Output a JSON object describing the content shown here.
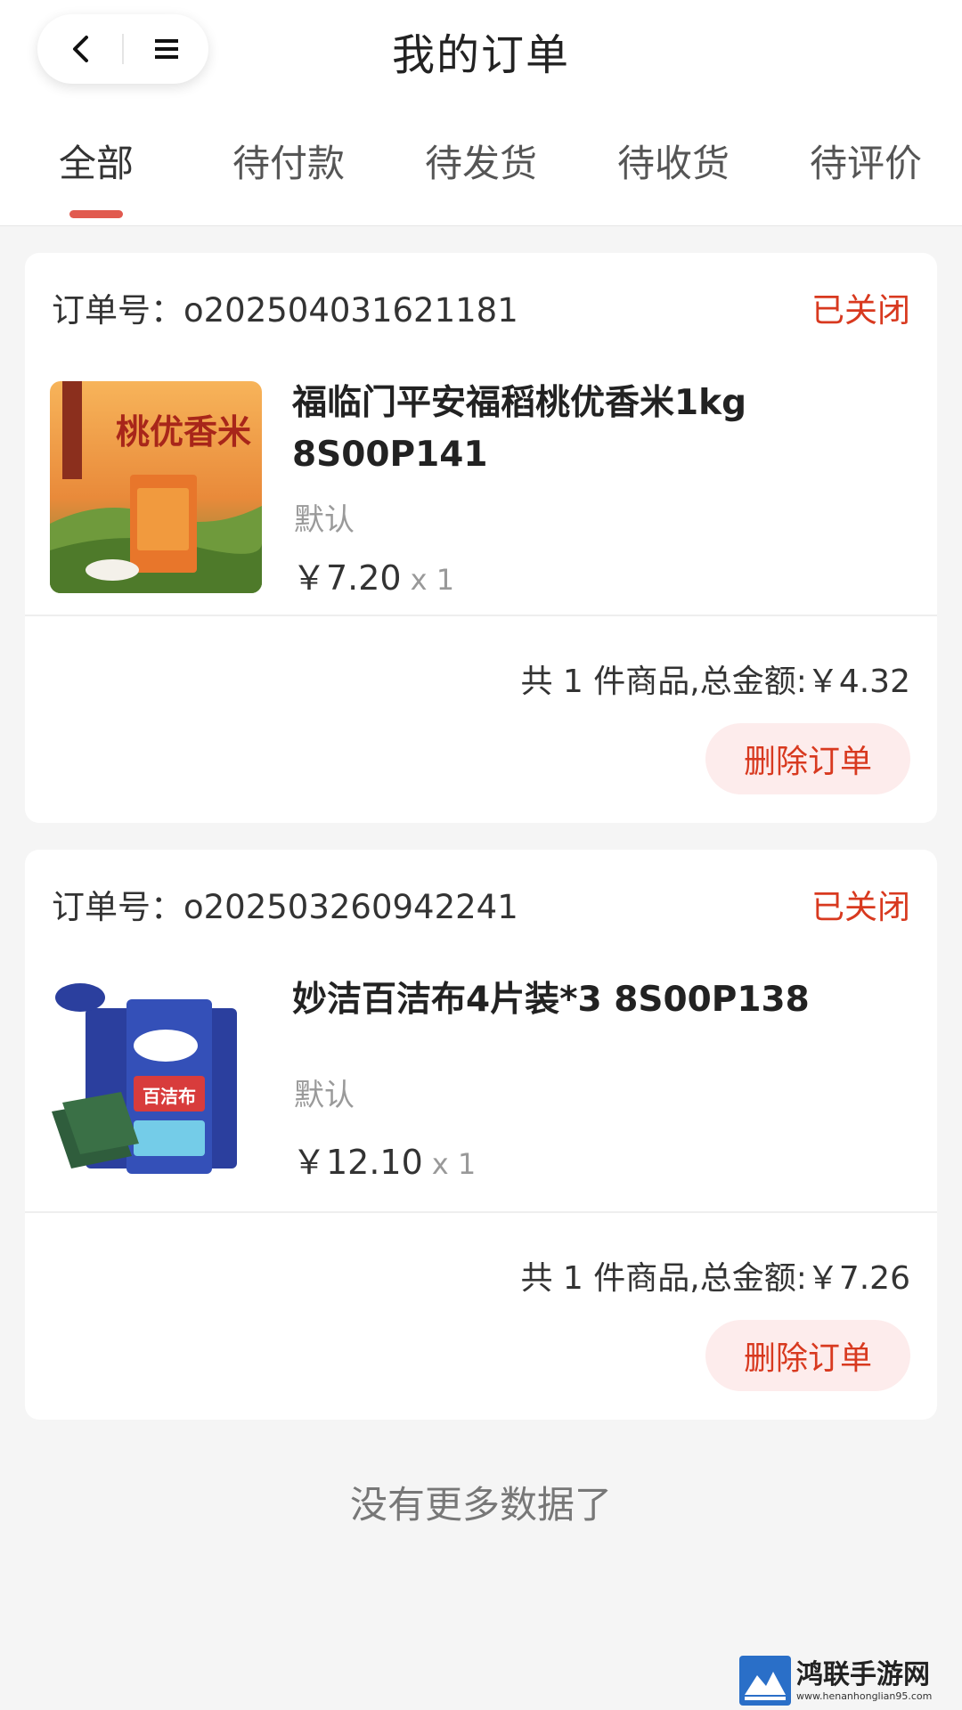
{
  "header": {
    "title": "我的订单",
    "back_icon": "chevron-left-icon",
    "menu_icon": "menu-icon"
  },
  "tabs": [
    {
      "label": "全部",
      "active": true
    },
    {
      "label": "待付款",
      "active": false
    },
    {
      "label": "待发货",
      "active": false
    },
    {
      "label": "待收货",
      "active": false
    },
    {
      "label": "待评价",
      "active": false
    }
  ],
  "orders": [
    {
      "order_no": "订单号：o202504031621181",
      "status": "已关闭",
      "product": {
        "title": "福临门平安福稻桃优香米1kg 8S00P141",
        "spec": "默认",
        "price": "￥7.20",
        "qty": "x 1",
        "image_text": "桃优香米"
      },
      "summary": "共 1 件商品,总金额:￥4.32",
      "delete_label": "删除订单"
    },
    {
      "order_no": "订单号：o202503260942241",
      "status": "已关闭",
      "product": {
        "title": "妙洁百洁布4片装*3 8S00P138",
        "spec": "默认",
        "price": "￥12.10",
        "qty": "x 1",
        "image_text": "百洁布"
      },
      "summary": "共 1 件商品,总金额:￥7.26",
      "delete_label": "删除订单"
    }
  ],
  "footer": {
    "no_more": "没有更多数据了"
  },
  "watermark": {
    "main": "鸿联手游网",
    "sub": "www.henanhonglian95.com"
  },
  "colors": {
    "accent": "#d8391f",
    "indicator": "#e15a4f",
    "delete_bg": "#fdecec"
  }
}
